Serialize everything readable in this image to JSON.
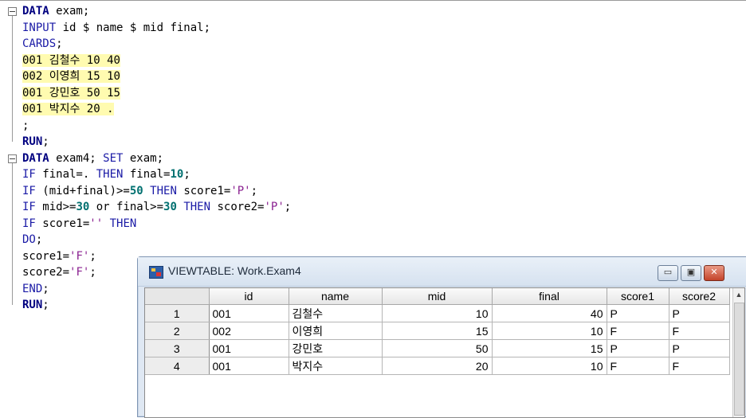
{
  "code": {
    "lines": [
      {
        "parts": [
          {
            "t": "DATA",
            "c": "kwb"
          },
          {
            "t": " exam;",
            "c": ""
          }
        ],
        "fold": true
      },
      {
        "parts": [
          {
            "t": "INPUT",
            "c": "kw"
          },
          {
            "t": " id $ name $ mid final;",
            "c": ""
          }
        ]
      },
      {
        "parts": [
          {
            "t": "CARDS",
            "c": "kw"
          },
          {
            "t": ";",
            "c": ""
          }
        ]
      },
      {
        "parts": [
          {
            "t": "001 김철수 10 40",
            "c": "hl"
          }
        ]
      },
      {
        "parts": [
          {
            "t": "002 이영희 15 10",
            "c": "hl"
          }
        ]
      },
      {
        "parts": [
          {
            "t": "001 강민호 50 15",
            "c": "hl"
          }
        ]
      },
      {
        "parts": [
          {
            "t": "001 박지수 20 .",
            "c": "hl"
          }
        ]
      },
      {
        "parts": [
          {
            "t": ";",
            "c": ""
          }
        ]
      },
      {
        "parts": [
          {
            "t": "RUN",
            "c": "kwb"
          },
          {
            "t": ";",
            "c": ""
          }
        ]
      },
      {
        "parts": [
          {
            "t": "DATA",
            "c": "kwb"
          },
          {
            "t": " exam4; ",
            "c": ""
          },
          {
            "t": "SET",
            "c": "kw"
          },
          {
            "t": " exam;",
            "c": ""
          }
        ],
        "fold": true
      },
      {
        "parts": [
          {
            "t": "IF",
            "c": "kw"
          },
          {
            "t": " final=. ",
            "c": ""
          },
          {
            "t": "THEN",
            "c": "kw"
          },
          {
            "t": " final=",
            "c": ""
          },
          {
            "t": "10",
            "c": "num"
          },
          {
            "t": ";",
            "c": ""
          }
        ]
      },
      {
        "parts": [
          {
            "t": "IF",
            "c": "kw"
          },
          {
            "t": " (mid+final)>=",
            "c": ""
          },
          {
            "t": "50",
            "c": "num"
          },
          {
            "t": " ",
            "c": ""
          },
          {
            "t": "THEN",
            "c": "kw"
          },
          {
            "t": " score1=",
            "c": ""
          },
          {
            "t": "'P'",
            "c": "str"
          },
          {
            "t": ";",
            "c": ""
          }
        ]
      },
      {
        "parts": [
          {
            "t": "IF",
            "c": "kw"
          },
          {
            "t": " mid>=",
            "c": ""
          },
          {
            "t": "30",
            "c": "num"
          },
          {
            "t": " or final>=",
            "c": ""
          },
          {
            "t": "30",
            "c": "num"
          },
          {
            "t": " ",
            "c": ""
          },
          {
            "t": "THEN",
            "c": "kw"
          },
          {
            "t": " score2=",
            "c": ""
          },
          {
            "t": "'P'",
            "c": "str"
          },
          {
            "t": ";",
            "c": ""
          }
        ]
      },
      {
        "parts": [
          {
            "t": "IF",
            "c": "kw"
          },
          {
            "t": " score1=",
            "c": ""
          },
          {
            "t": "''",
            "c": "str"
          },
          {
            "t": " ",
            "c": ""
          },
          {
            "t": "THEN",
            "c": "kw"
          }
        ]
      },
      {
        "parts": [
          {
            "t": "DO",
            "c": "kw"
          },
          {
            "t": ";",
            "c": ""
          }
        ]
      },
      {
        "parts": [
          {
            "t": "score1=",
            "c": ""
          },
          {
            "t": "'F'",
            "c": "str"
          },
          {
            "t": ";",
            "c": ""
          }
        ]
      },
      {
        "parts": [
          {
            "t": "score2=",
            "c": ""
          },
          {
            "t": "'F'",
            "c": "str"
          },
          {
            "t": ";",
            "c": ""
          }
        ]
      },
      {
        "parts": [
          {
            "t": "END",
            "c": "kw"
          },
          {
            "t": ";",
            "c": ""
          }
        ]
      },
      {
        "parts": [
          {
            "t": "RUN",
            "c": "kwb"
          },
          {
            "t": ";",
            "c": ""
          }
        ]
      }
    ]
  },
  "viewtable": {
    "title": "VIEWTABLE: Work.Exam4",
    "buttons": {
      "minimize": "▭",
      "maximize": "▣",
      "close": "✕"
    },
    "columns": [
      "id",
      "name",
      "mid",
      "final",
      "score1",
      "score2"
    ],
    "rows": [
      {
        "n": "1",
        "id": "001",
        "name": "김철수",
        "mid": "10",
        "final": "40",
        "score1": "P",
        "score2": "P"
      },
      {
        "n": "2",
        "id": "002",
        "name": "이영희",
        "mid": "15",
        "final": "10",
        "score1": "F",
        "score2": "F"
      },
      {
        "n": "3",
        "id": "001",
        "name": "강민호",
        "mid": "50",
        "final": "15",
        "score1": "P",
        "score2": "P"
      },
      {
        "n": "4",
        "id": "001",
        "name": "박지수",
        "mid": "20",
        "final": "10",
        "score1": "F",
        "score2": "F"
      }
    ],
    "scroll_up": "▲"
  }
}
